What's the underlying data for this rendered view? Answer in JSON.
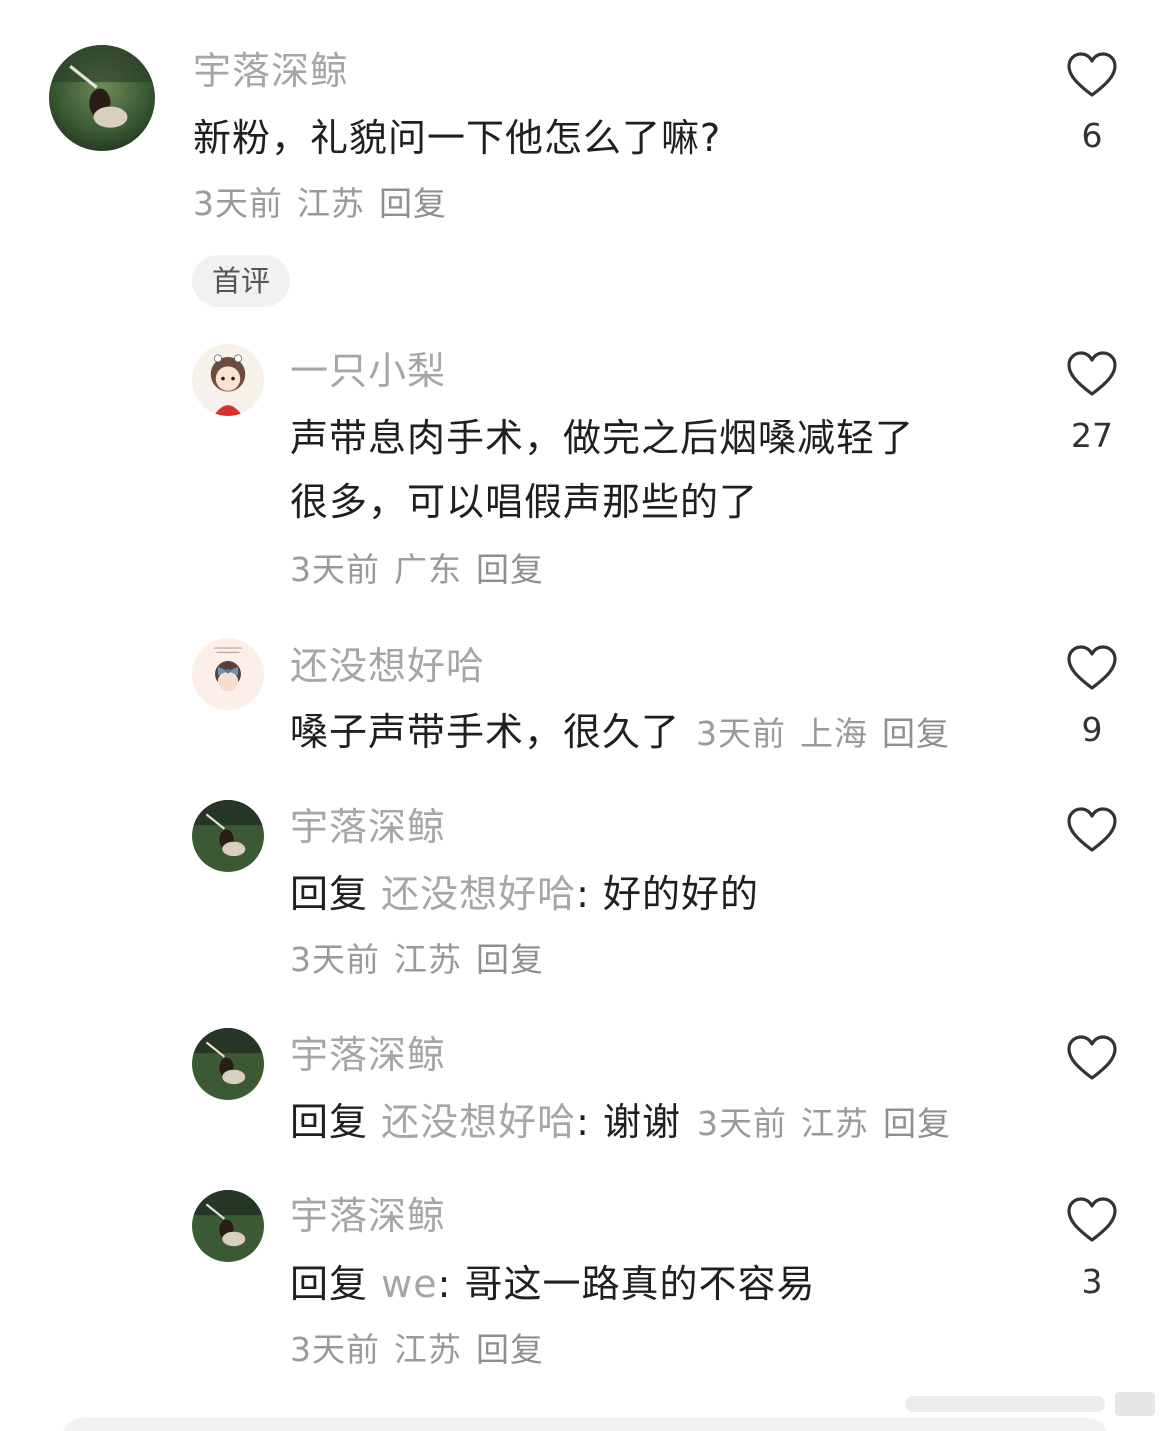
{
  "comments": [
    {
      "username": "宇落深鲸",
      "text": "新粉，礼貌问一下他怎么了嘛?",
      "time": "3天前",
      "location": "江苏",
      "reply_label": "回复",
      "likes": "6",
      "badge": "首评",
      "avatar": "photo-avatar-grassland"
    }
  ],
  "replies": [
    {
      "username": "一只小梨",
      "text_line1": "声带息肉手术，做完之后烟嗓减轻了",
      "text_line2": "很多，可以唱假声那些的了",
      "time": "3天前",
      "location": "广东",
      "reply_label": "回复",
      "likes": "27",
      "avatar": "cartoon-girl-avatar"
    },
    {
      "username": "还没想好哈",
      "text": "嗓子声带手术，很久了",
      "time": "3天前",
      "location": "上海",
      "reply_label": "回复",
      "likes": "9",
      "avatar": "bow-girl-avatar"
    },
    {
      "username": "宇落深鲸",
      "reply_prefix": "回复",
      "reply_target": "还没想好哈",
      "reply_sep": ":",
      "text": "好的好的",
      "time": "3天前",
      "location": "江苏",
      "reply_label": "回复",
      "likes": "",
      "avatar": "photo-avatar-grassland"
    },
    {
      "username": "宇落深鲸",
      "reply_prefix": "回复",
      "reply_target": "还没想好哈",
      "reply_sep": ":",
      "text": "谢谢",
      "time": "3天前",
      "location": "江苏",
      "reply_label": "回复",
      "likes": "",
      "avatar": "photo-avatar-grassland"
    },
    {
      "username": "宇落深鲸",
      "reply_prefix": "回复",
      "reply_target": "we",
      "reply_sep": ":",
      "text": "哥这一路真的不容易",
      "time": "3天前",
      "location": "江苏",
      "reply_label": "回复",
      "likes": "3",
      "avatar": "photo-avatar-grassland"
    }
  ],
  "colors": {
    "username": "#a6a6a6",
    "text": "#1f1f1f",
    "meta": "#9a9a9a",
    "heart_outline": "#333333",
    "badge_bg": "#f1f1f1"
  }
}
